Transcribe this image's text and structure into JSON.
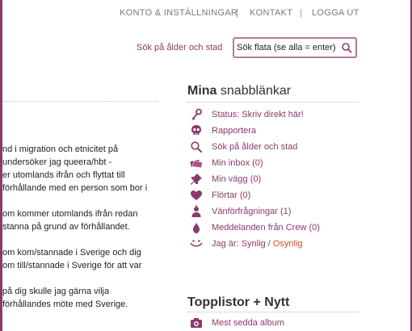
{
  "topnav": {
    "account": "KONTO & INSTÄLLNINGAR",
    "separator": "|",
    "contact": "KONTAKT",
    "logout": "LOGGA UT"
  },
  "search": {
    "label": "Sök på ålder och stad",
    "value": "Sök flata (se alla = enter)"
  },
  "article": {
    "lines": [
      "nd i migration och etnicitet på",
      "undersöker jag queera/hbt -",
      "er utomlands ifrån och flyttat till",
      "förhållande med en person som bor i",
      "",
      "om kommer utomlands ifrån redan",
      "stanna på grund av förhållandet.",
      "",
      "om kom/stannade i Sverige och dig",
      "om till/stannade i Sverige för att var",
      "",
      "på dig skulle jag gärna vilja",
      "förhållandes möte med Sverige."
    ]
  },
  "sidebar": {
    "heading_bold": "Mina",
    "heading_rest": "snabblänkar",
    "links": [
      {
        "icon": "key-icon",
        "label": "Status: Skriv direkt här!"
      },
      {
        "icon": "skull-icon",
        "label": "Rapportera"
      },
      {
        "icon": "magnifier-icon",
        "label": "Sök på ålder och stad"
      },
      {
        "icon": "letters-icon",
        "label": "Min inbox (0)"
      },
      {
        "icon": "pin-icon",
        "label": "Min vägg (0)"
      },
      {
        "icon": "heart-icon",
        "label": "Flörtar (0)"
      },
      {
        "icon": "friend-request-icon",
        "label": "Vänförfrågningar (1)"
      },
      {
        "icon": "crew-icon",
        "label": "Meddelanden från Crew (0)"
      }
    ],
    "visibility": {
      "icon": "visibility-icon",
      "prefix": "Jag är:",
      "visible": "Synlig",
      "slash": "/",
      "invisible": "Osynlig"
    },
    "top_heading": "Topplistor + Nytt",
    "top_item": {
      "icon": "camera-icon",
      "label": "Mest sedda album"
    }
  },
  "colors": {
    "accent": "#8c3a6b",
    "active": "#e04a1f"
  }
}
